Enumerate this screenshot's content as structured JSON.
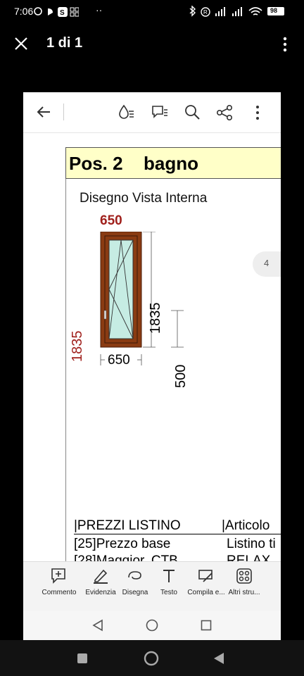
{
  "status_bar": {
    "time": "7:06",
    "battery": "98"
  },
  "viewer": {
    "title": "1 di 1"
  },
  "document": {
    "position_label": "Pos. 2",
    "room_label": "bagno",
    "view_title": "Disegno Vista Interna",
    "width_top": "650",
    "height_side": "1835",
    "height_frame": "1835",
    "handle_height": "500",
    "width_bottom": "650",
    "page_badge": "4"
  },
  "table": {
    "header_left": "|PREZZI LISTINO",
    "header_right": "|Articolo",
    "row1_left": "[25]Prezzo base",
    "row1_right": "Listino ti",
    "row2_left": "[28]Maggior. CTB",
    "row2_right": "RELAX"
  },
  "tools": [
    {
      "label": "Commento"
    },
    {
      "label": "Evidenzia"
    },
    {
      "label": "Disegna"
    },
    {
      "label": "Testo"
    },
    {
      "label": "Compila e..."
    },
    {
      "label": "Altri stru..."
    }
  ],
  "colors": {
    "accent_red": "#a0201c",
    "frame_brown": "#8a3b12",
    "glass": "#c6ece3",
    "header_yellow": "#ffffc8"
  }
}
